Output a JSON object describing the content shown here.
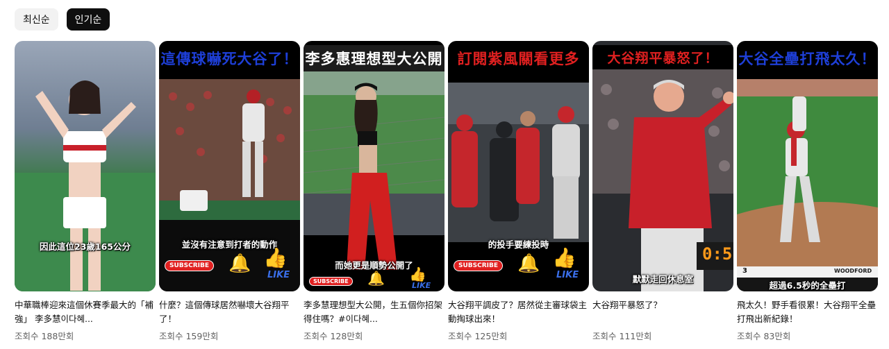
{
  "sort_chips": [
    {
      "label": "최신순",
      "active": false
    },
    {
      "label": "인기순",
      "active": true
    }
  ],
  "shorts": [
    {
      "headline": "",
      "caption": "因此這位23歲165公分",
      "title": "中華職棒迎來這個休賽季最大的「補強」 李多慧이다혜...",
      "views": "조회수 188만회"
    },
    {
      "headline": "這傳球嚇死大谷了！",
      "caption": "並沒有注意到打者的動作",
      "title": "什麼？這個傳球居然嚇壞大谷翔平了！",
      "views": "조회수 159만회"
    },
    {
      "headline": "李多惠理想型大公開",
      "caption": "而她更是順勢公開了",
      "title": "李多慧理想型大公開，生五個你招架得住嗎？#이다혜...",
      "views": "조회수 128만회"
    },
    {
      "headline": "訂閱紫風關看更多",
      "caption": "的投手要練投時",
      "title": "大谷翔平調皮了？居然從主審球袋主動掏球出來！",
      "views": "조회수 125만회"
    },
    {
      "headline": "大谷翔平暴怒了！",
      "caption": "默默走回休息室",
      "title": "大谷翔平暴怒了？",
      "views": "조회수 111만회"
    },
    {
      "headline": "大谷全壘打飛太久！",
      "caption": "超過6.5秒的全壘打",
      "title": "飛太久！野手看很累！大谷翔平全壘打飛出新紀錄！",
      "views": "조회수 83만회"
    }
  ],
  "overlays": {
    "subscribe": "SUBSCRIBE",
    "like": "LIKE",
    "scoreboard": "WOODFORD",
    "score_count": "3",
    "clock": "0:5"
  },
  "colors": {
    "accent_dark": "#0f0f0f",
    "chip_bg": "#f2f2f2",
    "meta_text": "#606060",
    "headline_blue": "#1e3fd8",
    "headline_red": "#e02020"
  }
}
